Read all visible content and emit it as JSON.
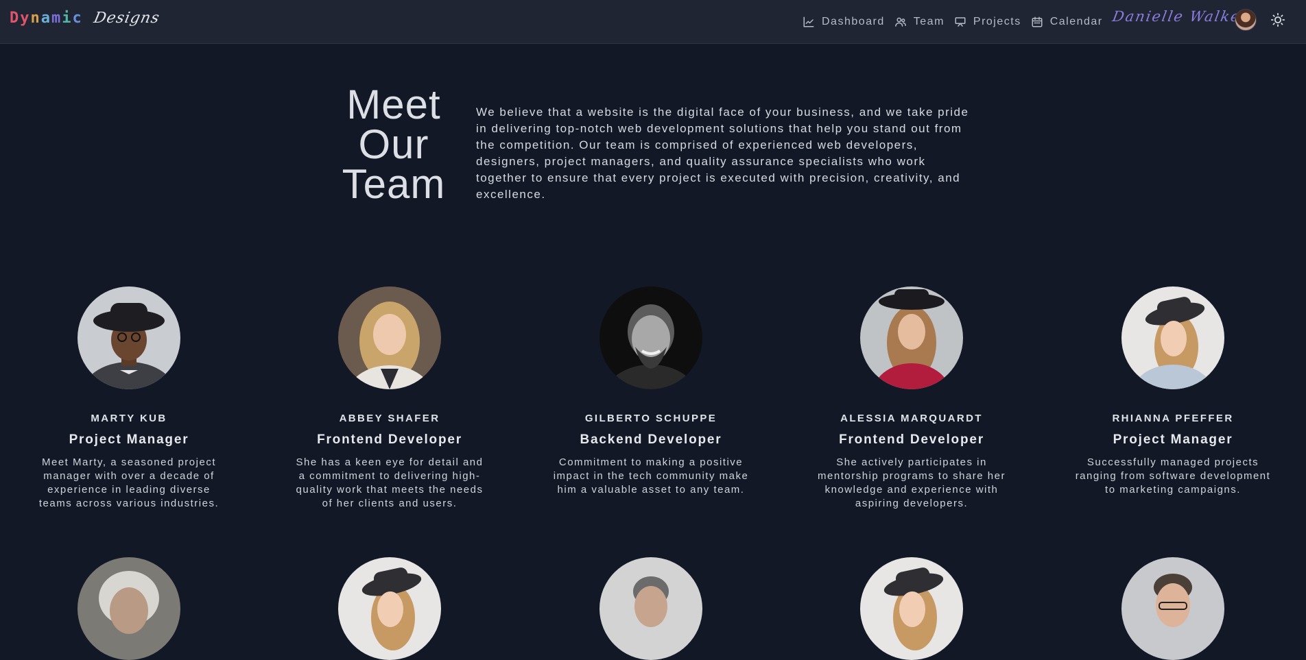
{
  "brand": {
    "word": "Dynamic",
    "script": "Designs"
  },
  "nav": {
    "links": [
      {
        "label": "Dashboard",
        "icon": "chart-line-icon"
      },
      {
        "label": "Team",
        "icon": "users-icon"
      },
      {
        "label": "Projects",
        "icon": "presentation-icon"
      },
      {
        "label": "Calendar",
        "icon": "calendar-icon"
      }
    ],
    "user_name": "Danielle Walker",
    "theme_icon": "sun-icon"
  },
  "hero": {
    "title_lines": [
      "Meet",
      "Our",
      "Team"
    ],
    "text": "We believe that a website is the digital face of your business, and we take pride in delivering top-notch web development solutions that help you stand out from the competition. Our team is comprised of experienced web developers, designers, project managers, and quality assurance specialists who work together to ensure that every project is executed with precision, creativity, and excellence."
  },
  "team": [
    {
      "name": "MARTY KUB",
      "role": "Project Manager",
      "bio": "Meet Marty, a seasoned project manager with over a decade of experience in leading diverse teams across various industries."
    },
    {
      "name": "ABBEY SHAFER",
      "role": "Frontend Developer",
      "bio": "She has a keen eye for detail and a commitment to delivering high-quality work that meets the needs of her clients and users."
    },
    {
      "name": "GILBERTO SCHUPPE",
      "role": "Backend Developer",
      "bio": "Commitment to making a positive impact in the tech community make him a valuable asset to any team."
    },
    {
      "name": "ALESSIA MARQUARDT",
      "role": "Frontend Developer",
      "bio": "She actively participates in mentorship programs to share her knowledge and experience with aspiring developers."
    },
    {
      "name": "RHIANNA PFEFFER",
      "role": "Project Manager",
      "bio": "Successfully managed projects ranging from software development to marketing campaigns."
    }
  ]
}
